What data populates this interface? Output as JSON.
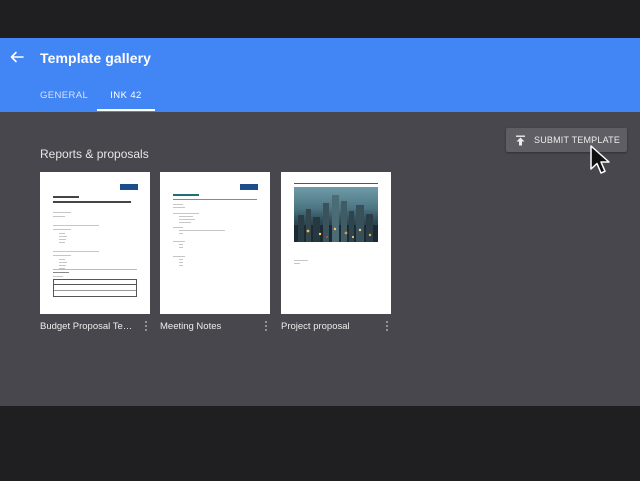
{
  "header": {
    "title": "Template gallery",
    "tabs": [
      {
        "label": "GENERAL",
        "active": false
      },
      {
        "label": "INK 42",
        "active": true
      }
    ]
  },
  "actions": {
    "submit_label": "SUBMIT TEMPLATE"
  },
  "section": {
    "title": "Reports & proposals"
  },
  "templates": [
    {
      "name": "Budget Proposal Template"
    },
    {
      "name": "Meeting Notes"
    },
    {
      "name": "Project proposal"
    }
  ],
  "colors": {
    "appbar": "#4285f4",
    "background": "#48474e",
    "frame": "#1f1f21",
    "accent_dark_blue": "#1c4f8a"
  }
}
